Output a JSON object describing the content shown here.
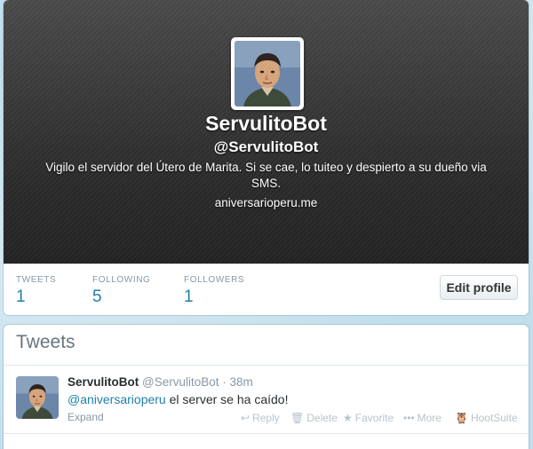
{
  "profile": {
    "name": "ServulitoBot",
    "handle": "@ServulitoBot",
    "bio": "Vigilo el servidor del Útero de Marita. Si se cae, lo tuiteo y despierto a su dueño via SMS.",
    "url": "aniversarioperu.me"
  },
  "stats": [
    {
      "label": "TWEETS",
      "value": "1"
    },
    {
      "label": "FOLLOWING",
      "value": "5"
    },
    {
      "label": "FOLLOWERS",
      "value": "1"
    }
  ],
  "edit_profile_label": "Edit profile",
  "tweets_section": {
    "title": "Tweets",
    "tweet": {
      "name": "ServulitoBot",
      "handle": "@ServulitoBot",
      "time": "· 38m",
      "mention": "@aniversarioperu",
      "text": " el server se ha caído!",
      "expand": "Expand",
      "actions": {
        "reply": "Reply",
        "delete": "Delete",
        "favorite": "Favorite",
        "more": "More",
        "hootsuite": "HootSuite"
      }
    }
  },
  "colors": {
    "background": "#c0deed",
    "link": "#1f7fa6",
    "muted": "#8899a6"
  }
}
